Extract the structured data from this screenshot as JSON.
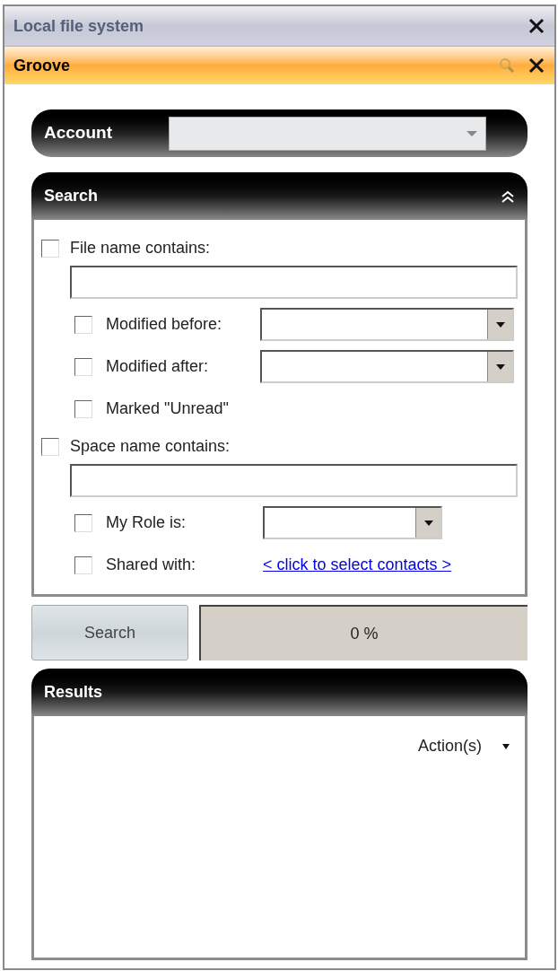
{
  "panes": [
    {
      "title": "Local file system",
      "selected": false
    },
    {
      "title": "Groove",
      "selected": true
    }
  ],
  "account": {
    "label": "Account"
  },
  "search_panel": {
    "title": "Search",
    "expanded": true,
    "criteria": [
      {
        "kind": "text",
        "label": "File name contains:",
        "checked": false,
        "children": [
          {
            "kind": "date",
            "label": "Modified before:",
            "checked": false
          },
          {
            "kind": "date",
            "label": "Modified after:",
            "checked": false
          },
          {
            "kind": "plain",
            "label": "Marked \"Unread\"",
            "checked": false
          }
        ]
      },
      {
        "kind": "text",
        "label": "Space name contains:",
        "checked": false,
        "children": [
          {
            "kind": "role",
            "label": "My Role is:",
            "checked": false
          },
          {
            "kind": "link",
            "label": "Shared with:",
            "checked": false,
            "link": "< click to select contacts >"
          }
        ]
      }
    ]
  },
  "search_button": "Search",
  "progress": {
    "level": 0,
    "reading": "0 %"
  },
  "results": {
    "title": "Results",
    "actions": "Action(s)"
  }
}
